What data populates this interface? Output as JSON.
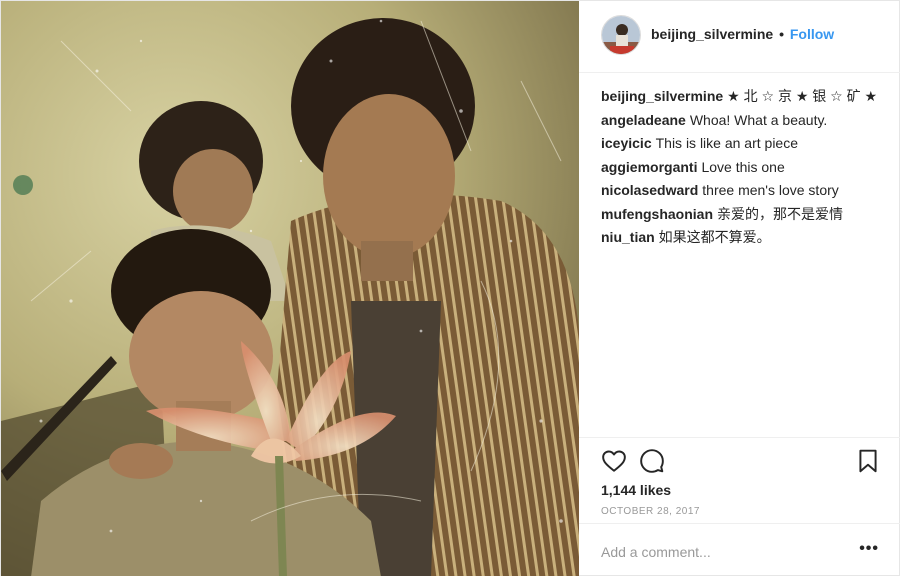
{
  "post": {
    "author": "beijing_silvermine",
    "separator": "•",
    "follow_label": "Follow",
    "comments": [
      {
        "user": "beijing_silvermine",
        "text": "★ 北 ☆ 京 ★ 银 ☆ 矿 ★"
      },
      {
        "user": "angeladeane",
        "text": "Whoa! What a beauty."
      },
      {
        "user": "iceyicic",
        "text": "This is like an art piece"
      },
      {
        "user": "aggiemorganti",
        "text": "Love this one"
      },
      {
        "user": "nicolasedward",
        "text": "three men's love story"
      },
      {
        "user": "mufengshaonian",
        "text": "亲爱的，那不是爱情"
      },
      {
        "user": "niu_tian",
        "text": "如果这都不算爱。"
      }
    ],
    "likes": "1,144 likes",
    "date": "OCTOBER 28, 2017",
    "add_comment_placeholder": "Add a comment...",
    "more_label": "•••"
  },
  "icons": {
    "like": "heart-icon",
    "comment": "speech-bubble-icon",
    "save": "bookmark-icon",
    "more": "more-options-icon"
  },
  "colors": {
    "accent": "#3897f0",
    "text": "#262626",
    "muted": "#999999",
    "border": "#efefef"
  }
}
